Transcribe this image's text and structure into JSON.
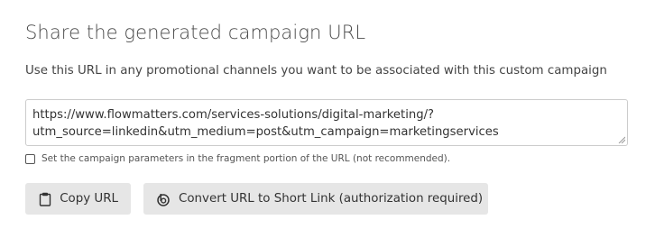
{
  "share": {
    "heading": "Share the generated campaign URL",
    "description": "Use this URL in any promotional channels you want to be associated with this custom campaign",
    "url_line1": "https://www.flowmatters.com/services-solutions/digital-marketing/?",
    "url_line2": "utm_source=linkedin&utm_medium=post&utm_campaign=marketingservices",
    "fragment_checkbox": {
      "label": "Set the campaign parameters in the fragment portion of the URL (not recommended).",
      "checked": false
    },
    "buttons": {
      "copy_label": "Copy URL",
      "copy_icon": "clipboard-icon",
      "short_label": "Convert URL to Short Link (authorization required)",
      "short_icon": "bitly-icon"
    }
  }
}
